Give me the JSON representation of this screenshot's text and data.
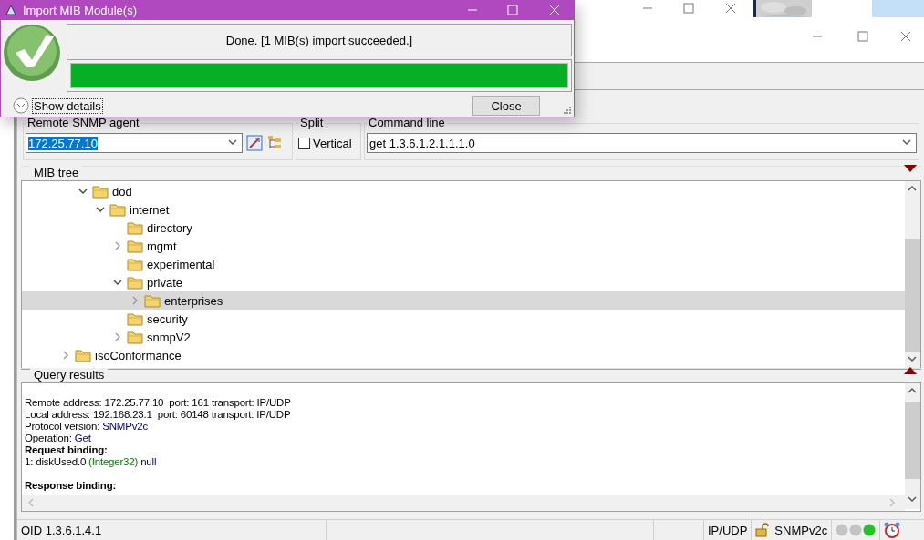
{
  "dialog": {
    "title": "Import MIB Module(s)",
    "message": "Done. [1 MIB(s) import succeeded.]",
    "progress": {
      "level": 1
    },
    "details_toggle": {
      "label": "Show details",
      "expanded": false
    },
    "buttons": [
      "Close"
    ]
  },
  "agent": {
    "legend": "Remote SNMP agent",
    "value": "172.25.77.10"
  },
  "split": {
    "legend": "Split",
    "checkbox": {
      "label": "Vertical",
      "checked": false
    }
  },
  "command_line": {
    "legend": "Command line",
    "value": "get 1.3.6.1.2.1.1.1.0"
  },
  "mib_tree": {
    "legend": "MIB tree",
    "items": [
      {
        "label": "dod",
        "kind": "nested-branch",
        "expanded": true,
        "selected": false,
        "children": [
          {
            "label": "internet",
            "kind": "branch",
            "expanded": true,
            "selected": false,
            "children": [
              {
                "label": "directory",
                "kind": "leaf",
                "selected": false
              },
              {
                "label": "mgmt",
                "kind": "branch",
                "expanded": false,
                "selected": false
              },
              {
                "label": "experimental",
                "kind": "leaf",
                "selected": false
              },
              {
                "label": "private",
                "kind": "branch",
                "expanded": true,
                "selected": false,
                "children": [
                  {
                    "label": "enterprises",
                    "kind": "branch",
                    "expanded": false,
                    "selected": true
                  }
                ]
              },
              {
                "label": "security",
                "kind": "leaf",
                "selected": false
              },
              {
                "label": "snmpV2",
                "kind": "branch",
                "expanded": false,
                "selected": false
              }
            ]
          }
        ]
      },
      {
        "label": "isoConformance",
        "kind": "branch",
        "expanded": false,
        "selected": false
      }
    ]
  },
  "query_results": {
    "legend": "Query results",
    "lines": [
      {
        "kind": "blank"
      },
      {
        "kind": "text",
        "parts": [
          {
            "text": "Remote address: 172.25.77.10  port: 161 transport: IP/UDP",
            "kind": "plain"
          }
        ]
      },
      {
        "kind": "text",
        "parts": [
          {
            "text": "Local address: 192.168.23.1  port: 60148 transport: IP/UDP",
            "kind": "plain"
          }
        ]
      },
      {
        "kind": "text",
        "parts": [
          {
            "text": "Protocol version: ",
            "kind": "plain"
          },
          {
            "text": "SNMPv2c",
            "kind": "value"
          }
        ]
      },
      {
        "kind": "text",
        "parts": [
          {
            "text": "Operation: ",
            "kind": "plain"
          },
          {
            "text": "Get",
            "kind": "value"
          }
        ]
      },
      {
        "kind": "text",
        "parts": [
          {
            "text": "Request binding:",
            "kind": "heading"
          }
        ]
      },
      {
        "kind": "text",
        "parts": [
          {
            "text": "1: diskUsed.0 ",
            "kind": "plain"
          },
          {
            "text": "(Integer32)",
            "kind": "type"
          },
          {
            "text": " null",
            "kind": "value"
          }
        ]
      },
      {
        "kind": "blank"
      },
      {
        "kind": "text",
        "parts": [
          {
            "text": "Response binding:",
            "kind": "heading"
          }
        ]
      }
    ]
  },
  "status_bar": {
    "oid": "OID 1.3.6.1.4.1",
    "transport": "IP/UDP",
    "version": "SNMPv2c",
    "lights": [
      {
        "color": "#c4c4c4"
      },
      {
        "color": "#c4c4c4"
      },
      {
        "color": "#22c322"
      }
    ]
  }
}
